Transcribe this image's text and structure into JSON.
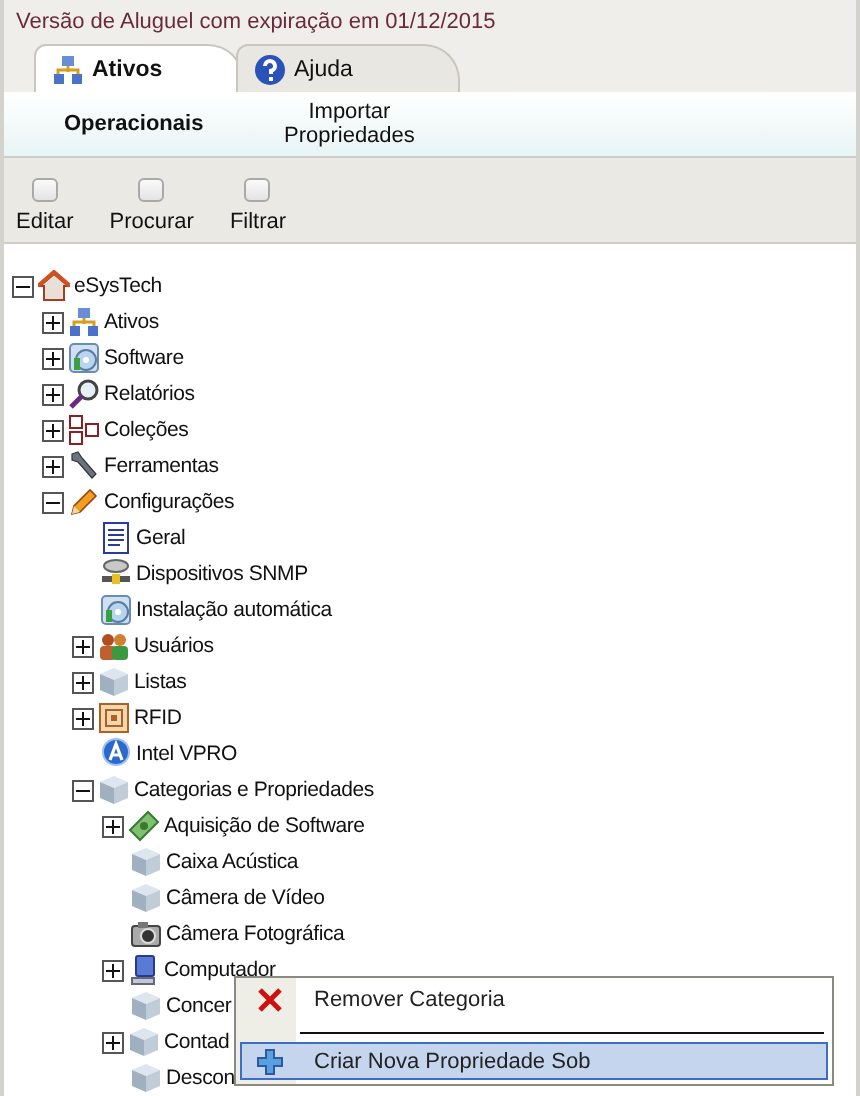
{
  "banner": "Versão de Aluguel com expiração em 01/12/2015",
  "tabs": [
    {
      "label": "Ativos",
      "kind": "network",
      "selected": true
    },
    {
      "label": "Ajuda",
      "kind": "help",
      "selected": false
    }
  ],
  "subnav": [
    {
      "label": "Operacionais",
      "selected": true
    },
    {
      "label": "Importar Propriedades",
      "selected": false
    }
  ],
  "toolbar": [
    "Editar",
    "Procurar",
    "Filtrar"
  ],
  "tree": [
    {
      "label": "eSysTech",
      "kind": "house",
      "expanded": true,
      "children": [
        {
          "label": "Ativos",
          "kind": "network",
          "expanded": false
        },
        {
          "label": "Software",
          "kind": "disc",
          "expanded": false
        },
        {
          "label": "Relatórios",
          "kind": "magnifier",
          "expanded": false
        },
        {
          "label": "Coleções",
          "kind": "collection",
          "expanded": false
        },
        {
          "label": "Ferramentas",
          "kind": "wrench",
          "expanded": false
        },
        {
          "label": "Configurações",
          "kind": "pencil",
          "expanded": true,
          "children": [
            {
              "label": "Geral",
              "kind": "document"
            },
            {
              "label": "Dispositivos SNMP",
              "kind": "server"
            },
            {
              "label": "Instalação automática",
              "kind": "disc"
            },
            {
              "label": "Usuários",
              "kind": "users",
              "expanded": false
            },
            {
              "label": "Listas",
              "kind": "cube",
              "expanded": false
            },
            {
              "label": "RFID",
              "kind": "rfid",
              "expanded": false
            },
            {
              "label": "Intel VPRO",
              "kind": "badge"
            },
            {
              "label": "Categorias e Propriedades",
              "kind": "cube",
              "expanded": true,
              "children": [
                {
                  "label": "Aquisição de Software",
                  "kind": "money",
                  "expanded": false
                },
                {
                  "label": "Caixa Acústica",
                  "kind": "cube"
                },
                {
                  "label": "Câmera de Vídeo",
                  "kind": "cube"
                },
                {
                  "label": "Câmera Fotográfica",
                  "kind": "camera"
                },
                {
                  "label": "Computador",
                  "kind": "computer",
                  "expanded": false
                },
                {
                  "label": "Concer",
                  "kind": "cube"
                },
                {
                  "label": "Contad",
                  "kind": "cube",
                  "expanded": false
                },
                {
                  "label": "Descon",
                  "kind": "cube"
                }
              ]
            }
          ]
        }
      ]
    }
  ],
  "context_menu": [
    {
      "label": "Remover Categoria",
      "kind": "remove",
      "selected": false
    },
    {
      "kind": "separator"
    },
    {
      "label": "Criar Nova Propriedade Sob",
      "kind": "add",
      "selected": true
    }
  ]
}
